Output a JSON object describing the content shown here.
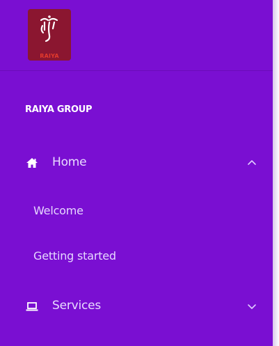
{
  "logo": {
    "text": "RAIYA",
    "icon": "raiya-logo-icon",
    "bg_color": "#8b1630"
  },
  "sidebar": {
    "group_title": "RAIYA GROUP",
    "bg_color": "#7a0fd2",
    "items": [
      {
        "label": "Home",
        "icon": "home-icon",
        "expanded": true,
        "chevron": "chevron-up-icon",
        "sub_items": [
          {
            "label": "Welcome"
          },
          {
            "label": "Getting started"
          }
        ]
      },
      {
        "label": "Services",
        "icon": "laptop-icon",
        "expanded": false,
        "chevron": "chevron-down-icon",
        "sub_items": []
      }
    ]
  }
}
